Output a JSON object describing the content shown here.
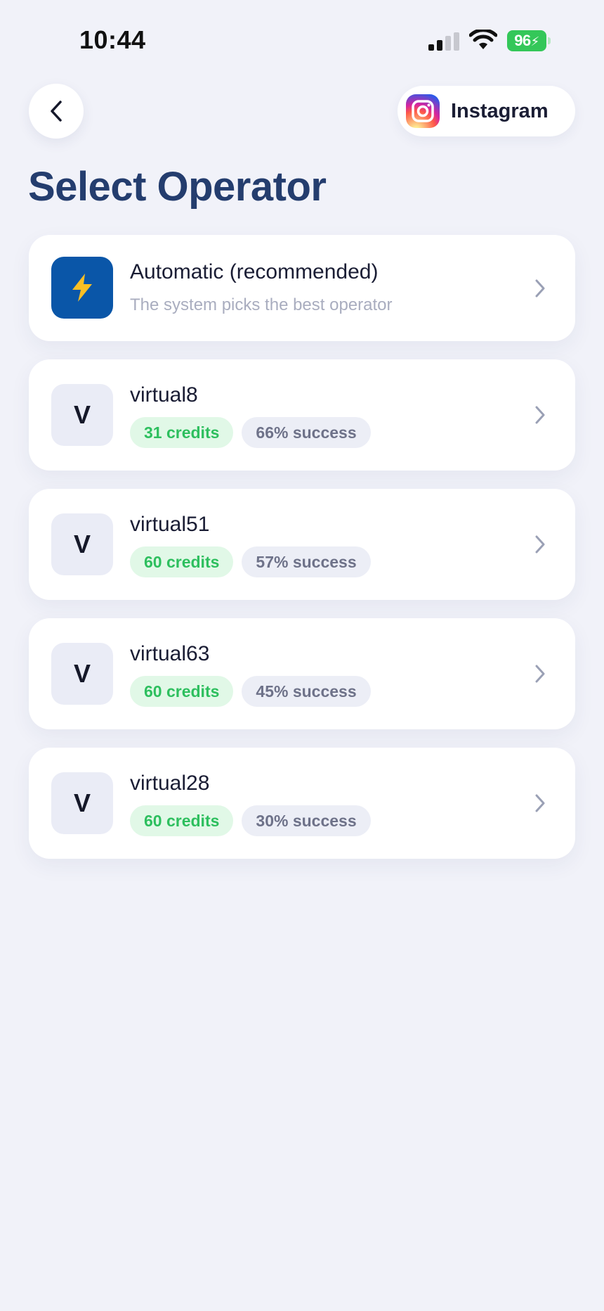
{
  "status_bar": {
    "time": "10:44",
    "battery": "96"
  },
  "header": {
    "service_name": "Instagram",
    "service_icon": "instagram-icon",
    "title": "Select Operator"
  },
  "automatic": {
    "icon": "lightning-icon",
    "title": "Automatic (recommended)",
    "subtitle": "The system picks the best operator"
  },
  "operators": [
    {
      "avatar": "V",
      "name": "virtual8",
      "credits": "31 credits",
      "success": "66% success"
    },
    {
      "avatar": "V",
      "name": "virtual51",
      "credits": "60 credits",
      "success": "57% success"
    },
    {
      "avatar": "V",
      "name": "virtual63",
      "credits": "60 credits",
      "success": "45% success"
    },
    {
      "avatar": "V",
      "name": "virtual28",
      "credits": "60 credits",
      "success": "30% success"
    }
  ],
  "colors": {
    "title": "#243d6e",
    "credits_text": "#2dbf5e",
    "credits_bg": "#e1f8e7",
    "success_text": "#6e7289",
    "success_bg": "#eceef6",
    "auto_icon_bg": "#0a56a8",
    "battery": "#34c759"
  }
}
